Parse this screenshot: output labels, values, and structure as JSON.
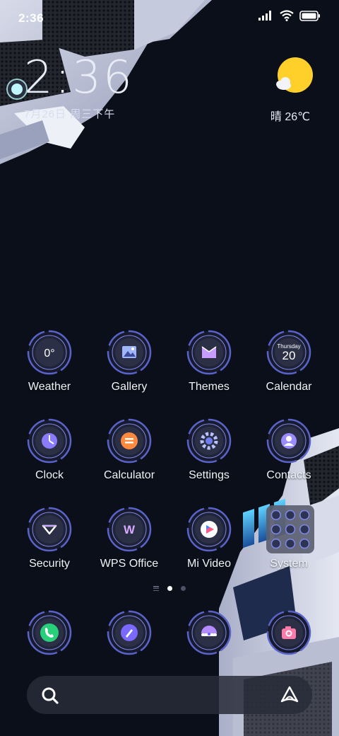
{
  "status_bar": {
    "time": "2:36"
  },
  "clock_widget": {
    "time": "2:36",
    "date": "7月26日 周三下午"
  },
  "weather_widget": {
    "text": "晴 26℃",
    "icon": "sunny-cloud-icon"
  },
  "apps": [
    {
      "label": "Weather",
      "icon": "weather-icon",
      "glyph": "0°"
    },
    {
      "label": "Gallery",
      "icon": "gallery-icon"
    },
    {
      "label": "Themes",
      "icon": "themes-icon"
    },
    {
      "label": "Calendar",
      "icon": "calendar-icon",
      "day_name": "Thursday",
      "day": "20"
    },
    {
      "label": "Clock",
      "icon": "clock-icon"
    },
    {
      "label": "Calculator",
      "icon": "calculator-icon"
    },
    {
      "label": "Settings",
      "icon": "settings-icon"
    },
    {
      "label": "Contacts",
      "icon": "contacts-icon"
    },
    {
      "label": "Security",
      "icon": "security-icon"
    },
    {
      "label": "WPS Office",
      "icon": "wps-office-icon"
    },
    {
      "label": "Mi Video",
      "icon": "mi-video-icon"
    },
    {
      "label": "System",
      "icon": "system-folder-icon"
    }
  ],
  "page_indicator": {
    "current": 1,
    "pages": 2
  },
  "dock": [
    {
      "icon": "phone-icon"
    },
    {
      "icon": "browser-icon"
    },
    {
      "icon": "messages-icon"
    },
    {
      "icon": "camera-icon"
    }
  ],
  "search_bar": {
    "icon": "search-icon",
    "assistant_icon": "assistant-icon"
  },
  "colors": {
    "accent": "#7d86ff",
    "ring": "#6a74e8",
    "background": "#0b0f19"
  }
}
